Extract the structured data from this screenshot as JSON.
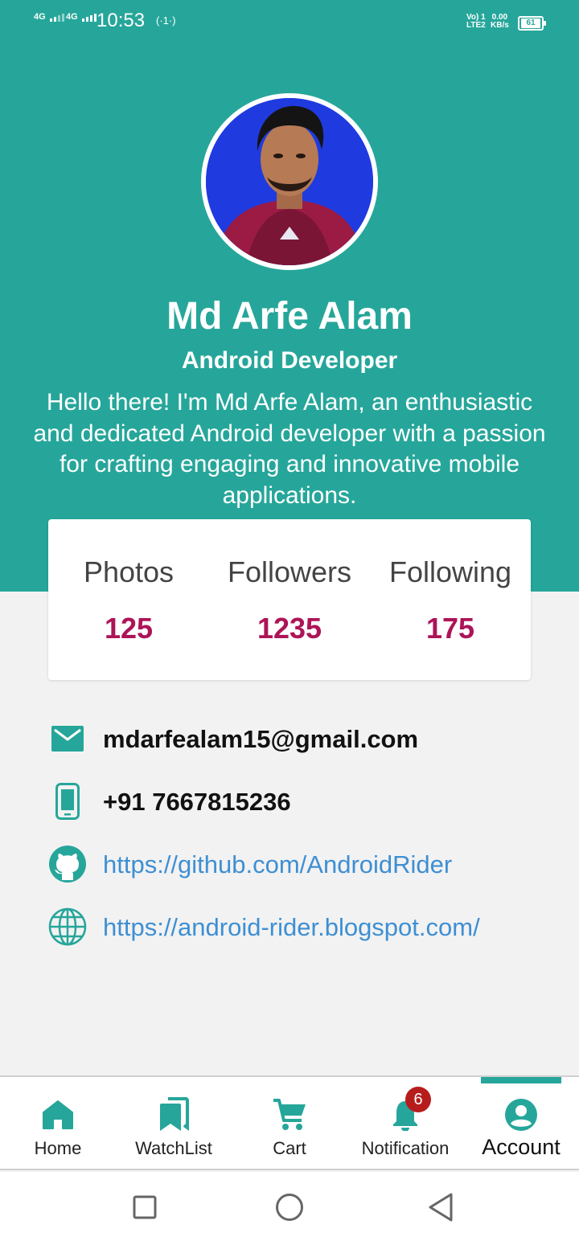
{
  "status_bar": {
    "sim1": "4G",
    "sim2": "4G",
    "time": "10:53",
    "hotspot": "(·1·)",
    "volte_top": "Vo) 1",
    "volte_bottom": "LTE2",
    "speed_value": "0.00",
    "speed_unit": "KB/s",
    "battery": "61"
  },
  "profile": {
    "name": "Md Arfe Alam",
    "role": "Android Developer",
    "bio": "Hello there! I'm Md Arfe Alam, an enthusiastic and dedicated Android developer with a passion for crafting engaging and innovative mobile applications."
  },
  "stats": [
    {
      "label": "Photos",
      "value": "125"
    },
    {
      "label": "Followers",
      "value": "1235"
    },
    {
      "label": "Following",
      "value": "175"
    }
  ],
  "contacts": {
    "email": "mdarfealam15@gmail.com",
    "phone": "+91 7667815236",
    "github": "https://github.com/AndroidRider",
    "website": "https://android-rider.blogspot.com/"
  },
  "bottom_nav": {
    "items": [
      {
        "label": "Home",
        "icon": "home-icon"
      },
      {
        "label": "WatchList",
        "icon": "bookmarks-icon"
      },
      {
        "label": "Cart",
        "icon": "cart-icon"
      },
      {
        "label": "Notification",
        "icon": "bell-icon"
      },
      {
        "label": "Account",
        "icon": "account-icon"
      }
    ],
    "active": "Account",
    "notification_badge": "6"
  },
  "colors": {
    "primary": "#26a69a",
    "stat_value": "#ad1457",
    "link": "#3e8fd3",
    "badge": "#b71c1c"
  }
}
